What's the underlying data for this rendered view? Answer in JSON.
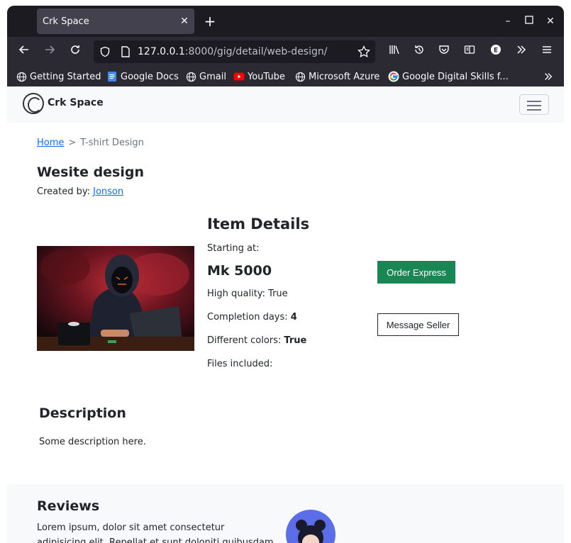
{
  "browser": {
    "tab_title": "Crk Space",
    "tab_close": "✕",
    "new_tab": "+",
    "url_host": "127.0.0.1",
    "url_rest": ":8000/gig/detail/web-design/",
    "window_controls": {
      "minimize": "–",
      "maximize": "☐",
      "close": "✕"
    }
  },
  "bookmarks": [
    {
      "label": "Getting Started",
      "icon": "globe-icon"
    },
    {
      "label": "Google Docs",
      "icon": "docs-icon"
    },
    {
      "label": "Gmail",
      "icon": "globe-icon"
    },
    {
      "label": "YouTube",
      "icon": "youtube-icon"
    },
    {
      "label": "Microsoft Azure",
      "icon": "globe-icon"
    },
    {
      "label": "Google Digital Skills f...",
      "icon": "google-icon"
    }
  ],
  "navbar": {
    "brand": "Crk Space"
  },
  "breadcrumb": {
    "home": "Home",
    "separator": ">",
    "current": "T-shirt Design"
  },
  "gig": {
    "title": "Wesite design",
    "created_by_label": "Created by:",
    "creator": "Jonson"
  },
  "details": {
    "heading": "Item Details",
    "starting_at": "Starting at:",
    "price": "Mk 5000",
    "high_quality": "High quality: True",
    "completion_label": "Completion days:",
    "completion_value": "4",
    "colors_label": "Different colors:",
    "colors_value": "True",
    "files": "Files included:"
  },
  "actions": {
    "order": "Order Express",
    "message": "Message Seller"
  },
  "description": {
    "heading": "Description",
    "text": "Some description here."
  },
  "reviews": {
    "heading": "Reviews",
    "text": "Lorem ipsum, dolor sit amet consectetur adipisicing elit. Repellat et sunt doloniti quibusdam beatae"
  },
  "colors": {
    "accent": "#198754",
    "link": "#0d6efd",
    "chrome": "#2b2a33"
  }
}
